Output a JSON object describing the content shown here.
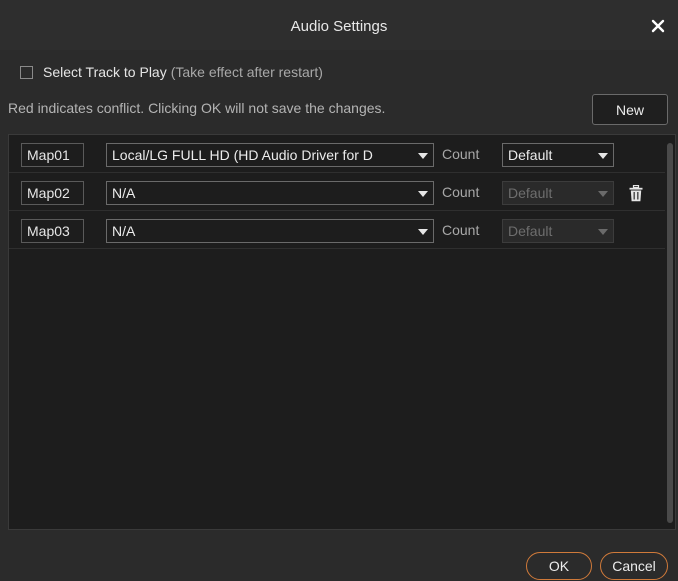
{
  "window": {
    "title": "Audio Settings",
    "close_icon": "close-icon"
  },
  "options": {
    "select_track_label": "Select Track to Play",
    "select_track_hint": "(Take effect after restart)",
    "select_track_checked": false
  },
  "info": {
    "text": "Red indicates conflict. Clicking OK will not save the changes.",
    "new_button": "New"
  },
  "maps": [
    {
      "label": "Map01",
      "device": "Local/LG FULL HD (HD Audio Driver for D",
      "count_label": "Count",
      "count": "Default",
      "count_enabled": true,
      "deletable": false
    },
    {
      "label": "Map02",
      "device": "N/A",
      "count_label": "Count",
      "count": "Default",
      "count_enabled": false,
      "deletable": true
    },
    {
      "label": "Map03",
      "device": "N/A",
      "count_label": "Count",
      "count": "Default",
      "count_enabled": false,
      "deletable": false
    }
  ],
  "footer": {
    "ok": "OK",
    "cancel": "Cancel"
  },
  "colors": {
    "accent_border": "#d07a3a",
    "background": "#2b2b2b",
    "panel": "#1d1d1d"
  }
}
